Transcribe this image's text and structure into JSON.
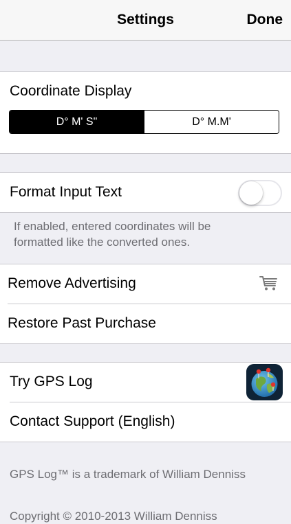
{
  "nav": {
    "title": "Settings",
    "done_label": "Done"
  },
  "coordinate_display": {
    "label": "Coordinate Display",
    "options": [
      "D° M' S\"",
      "D° M.M'"
    ],
    "selected": "D° M' S\""
  },
  "format_input": {
    "label": "Format Input Text",
    "enabled": false,
    "footer": "If enabled, entered coordinates will be formatted like the converted ones."
  },
  "purchases": {
    "remove_ads_label": "Remove Advertising",
    "remove_ads_icon": "shopping-cart-icon",
    "restore_label": "Restore Past Purchase"
  },
  "links": {
    "gps_log_label": "Try GPS Log",
    "gps_log_icon": "gps-log-app-icon",
    "support_label": "Contact Support (English)"
  },
  "footer": {
    "trademark": "GPS Log™ is a trademark of William Denniss",
    "copyright": "Copyright © 2010-2013 William Denniss"
  },
  "colors": {
    "background": "#efeff4",
    "cell": "#ffffff",
    "separator": "#c8c7cc",
    "footer_text": "#6d6d72",
    "accent": "#000000"
  }
}
